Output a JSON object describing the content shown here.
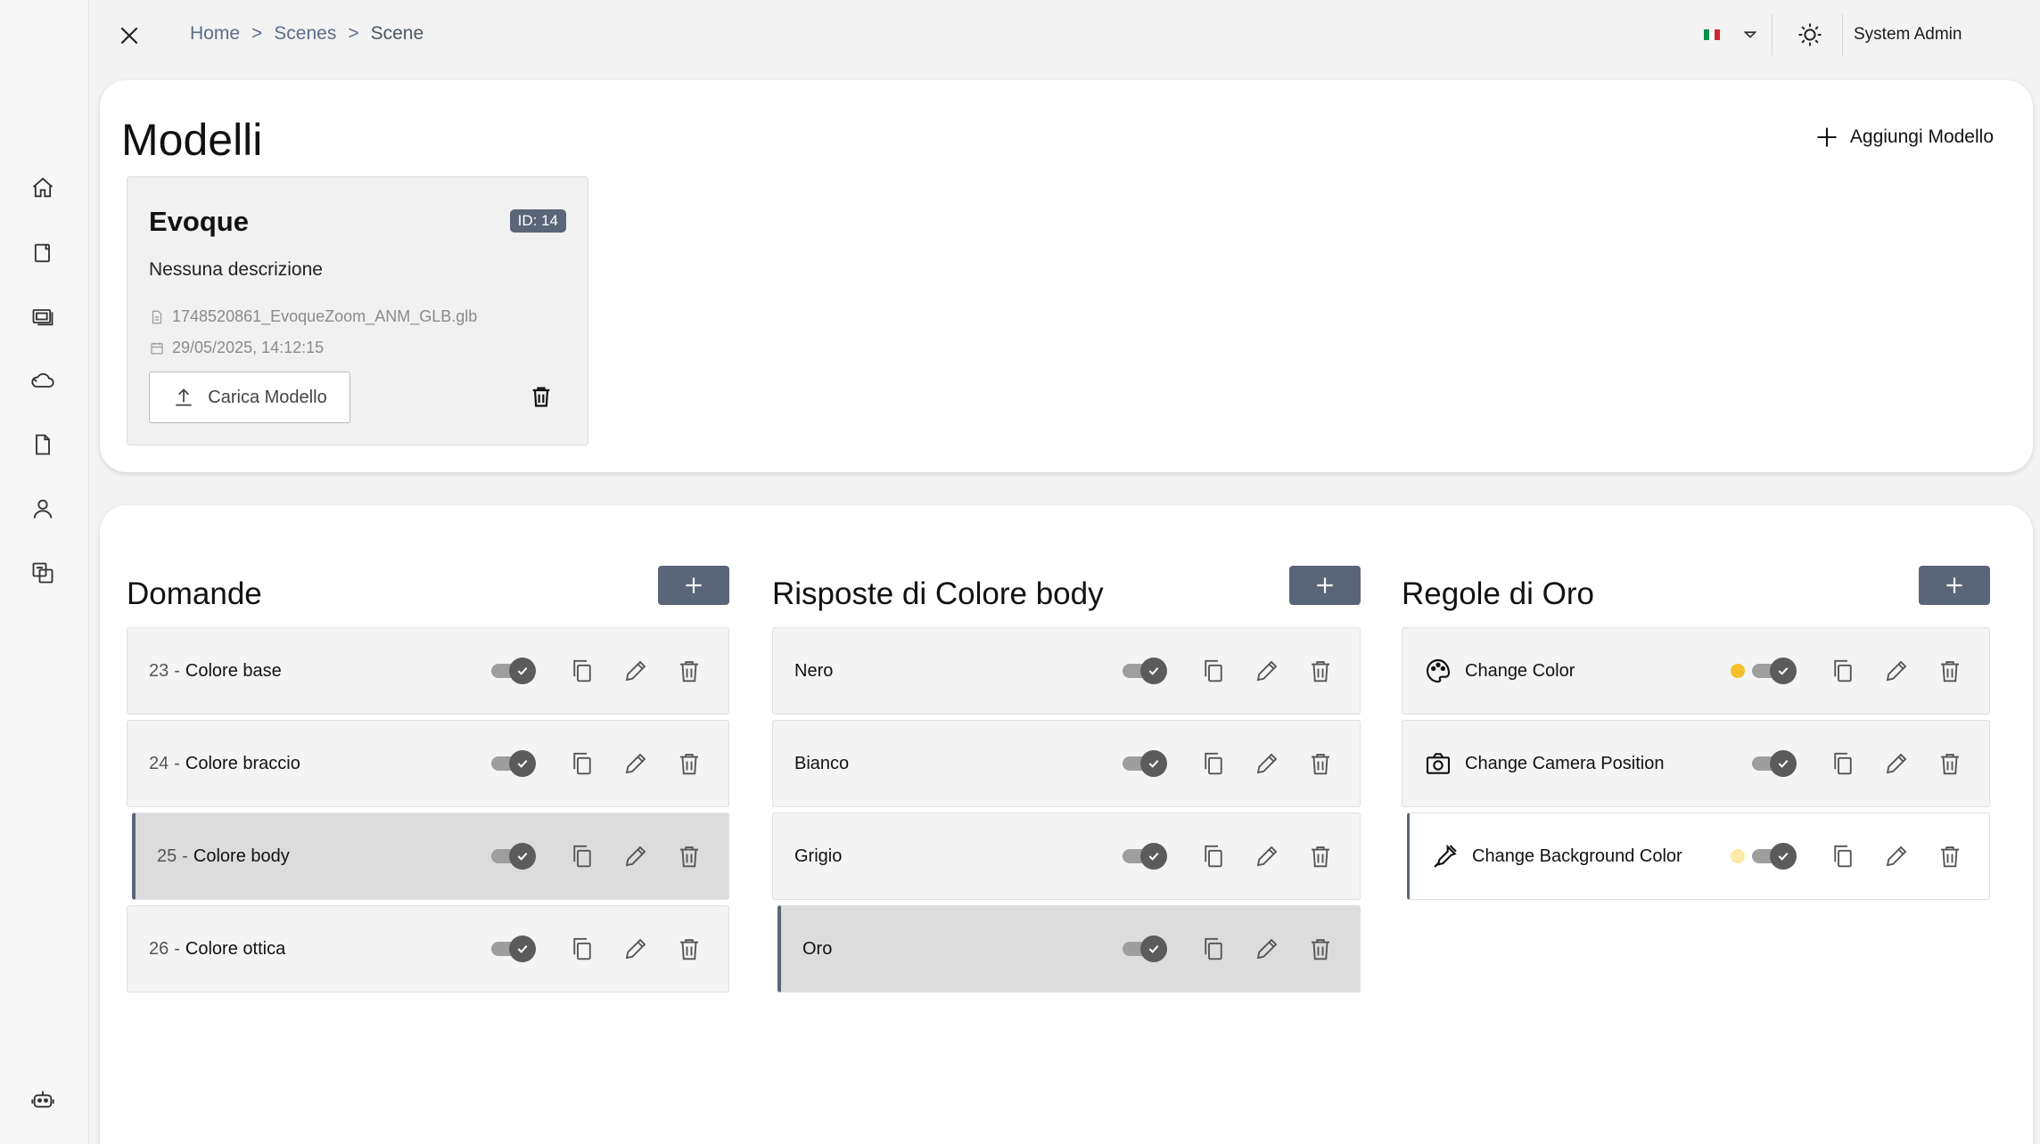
{
  "breadcrumb": {
    "home": "Home",
    "sep1": ">",
    "scenes": "Scenes",
    "sep2": ">",
    "current": "Scene"
  },
  "header": {
    "user_name": "System Admin",
    "flag_colors": [
      "#009246",
      "#ffffff",
      "#ce2b37"
    ]
  },
  "models": {
    "title": "Modelli",
    "add_label": "Aggiungi Modello",
    "card": {
      "name": "Evoque",
      "id_badge": "ID: 14",
      "description": "Nessuna descrizione",
      "file_name": "1748520861_EvoqueZoom_ANM_GLB.glb",
      "date": "29/05/2025, 14:12:15",
      "upload_label": "Carica Modello"
    }
  },
  "columns": {
    "domande": {
      "title": "Domande",
      "items": [
        {
          "id": "23",
          "sep": "-",
          "label": "Colore base",
          "enabled": true
        },
        {
          "id": "24",
          "sep": "-",
          "label": "Colore braccio",
          "enabled": true
        },
        {
          "id": "25",
          "sep": "-",
          "label": "Colore body",
          "enabled": true,
          "selected": true
        },
        {
          "id": "26",
          "sep": "-",
          "label": "Colore ottica",
          "enabled": true
        }
      ]
    },
    "risposte": {
      "title": "Risposte di Colore body",
      "items": [
        {
          "label": "Nero",
          "enabled": true
        },
        {
          "label": "Bianco",
          "enabled": true
        },
        {
          "label": "Grigio",
          "enabled": true
        },
        {
          "label": "Oro",
          "enabled": true,
          "selected": true
        }
      ]
    },
    "regole": {
      "title": "Regole di Oro",
      "items": [
        {
          "icon": "palette-icon",
          "label": "Change Color",
          "enabled": true,
          "dot_color": "#f5c02c"
        },
        {
          "icon": "camera-icon",
          "label": "Change Camera Position",
          "enabled": true
        },
        {
          "icon": "eyedropper-icon",
          "label": "Change Background Color",
          "enabled": true,
          "dot_color": "#fbeaa6"
        }
      ]
    }
  },
  "colors": {
    "accent": "#5b6579",
    "toggle_knob": "#5b5b5b",
    "selected_row": "#dcdcdc"
  }
}
